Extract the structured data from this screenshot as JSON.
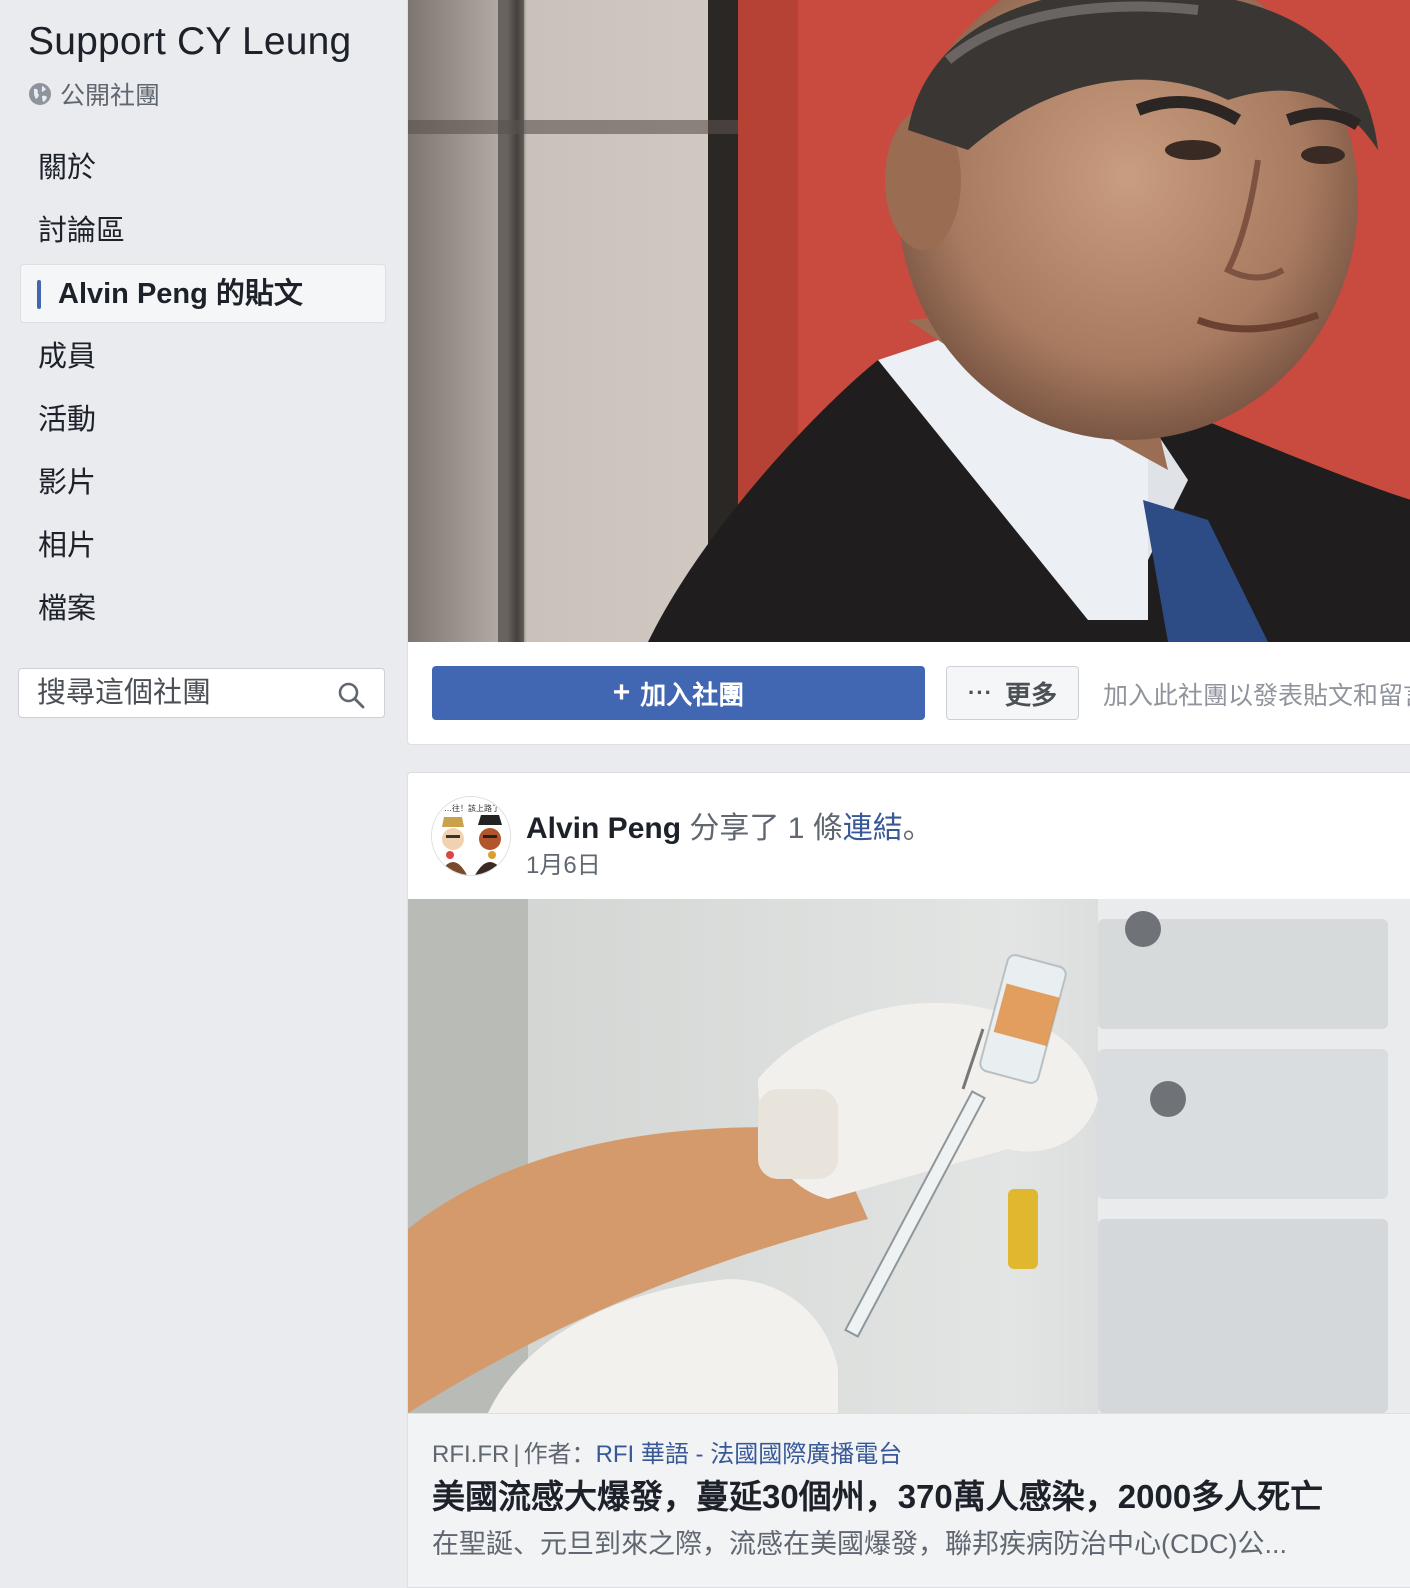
{
  "group": {
    "title": "Support CY Leung",
    "privacy": "公開社團"
  },
  "nav": {
    "items": [
      {
        "label": "關於",
        "active": false
      },
      {
        "label": "討論區",
        "active": false
      },
      {
        "label": "Alvin Peng 的貼文",
        "active": true
      },
      {
        "label": "成員",
        "active": false
      },
      {
        "label": "活動",
        "active": false
      },
      {
        "label": "影片",
        "active": false
      },
      {
        "label": "相片",
        "active": false
      },
      {
        "label": "檔案",
        "active": false
      }
    ]
  },
  "search": {
    "placeholder": "搜尋這個社團",
    "icon": "search-icon"
  },
  "cover": {
    "join_label": "加入社團",
    "join_plus": "+",
    "more_dots": "···",
    "more_label": "更多",
    "hint": "加入此社團以發表貼文和留言"
  },
  "post": {
    "author": "Alvin Peng",
    "action_prefix": " 分享了 1 條",
    "action_link": "連結",
    "action_suffix": "。",
    "date": "1月6日",
    "avatar_text": "…往！該上路了",
    "link": {
      "domain": "RFI.FR",
      "separator": "|",
      "author_prefix": "作者：",
      "author": "RFI 華語 - 法國國際廣播電台",
      "title": "美國流感大爆發，蔓延30個州，370萬人感染，2000多人死亡",
      "description": "在聖誕、元旦到來之際，流感在美國爆發，聯邦疾病防治中心(CDC)公..."
    }
  },
  "colors": {
    "brand_blue": "#4267b2",
    "link_blue": "#385898",
    "background": "#e9ebee"
  }
}
